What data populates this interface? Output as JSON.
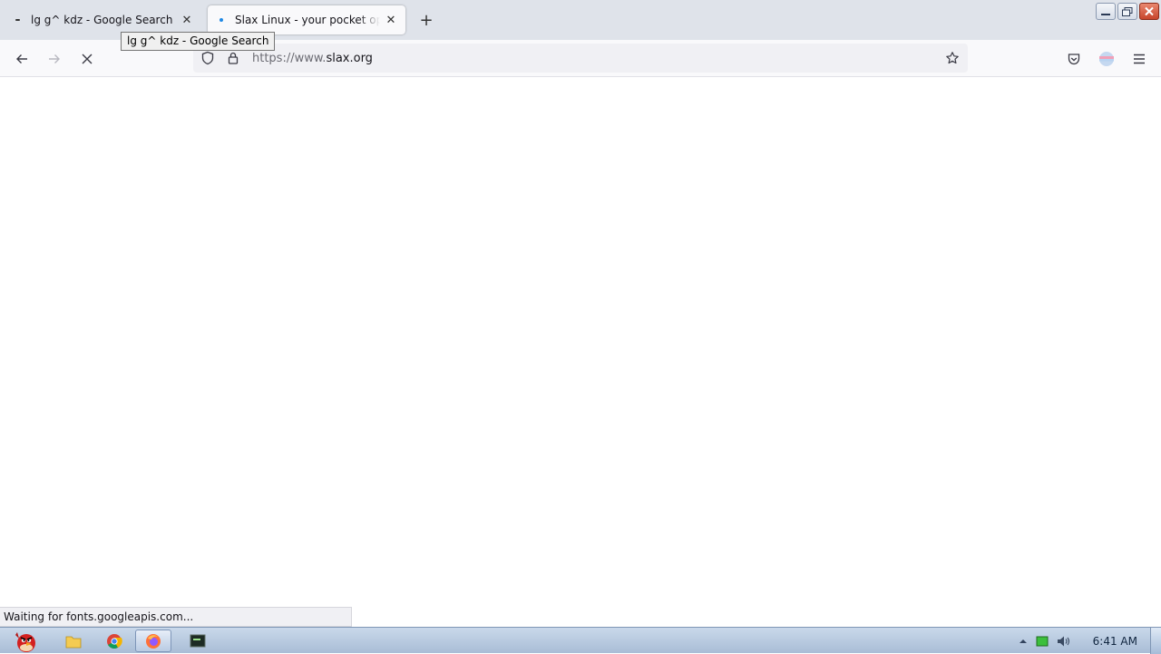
{
  "tabs": [
    {
      "title": "lg g^ kdz - Google Search",
      "close": "✕",
      "active": false
    },
    {
      "title": "Slax Linux - your pocket operating system",
      "close": "✕",
      "active": true
    }
  ],
  "new_tab": "+",
  "tooltip": "lg g^ kdz - Google Search",
  "urlbar": {
    "scheme": "https://www.",
    "host": "slax.org"
  },
  "status_text": "Waiting for fonts.googleapis.com...",
  "taskbar": {
    "clock": "6:41 AM"
  },
  "colors": {
    "tab_strip": "#dfe3ea",
    "toolbar": "#f9f9fb",
    "accent": "#1e88e5"
  }
}
